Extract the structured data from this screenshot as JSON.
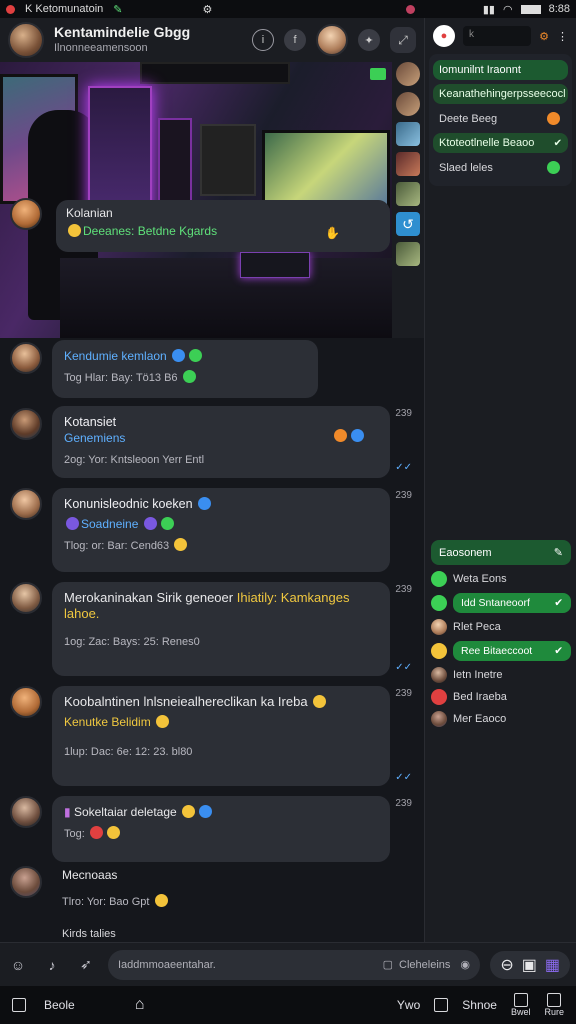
{
  "statusbar": {
    "app": "K Ketomunatoin",
    "time": "8:88"
  },
  "header": {
    "title": "Kentamindelie Gbgg",
    "subtitle": "Ilnonneeamensoon"
  },
  "messages": [
    {
      "name": "Kolanian",
      "text": "Deeanes: Betdne Kgards",
      "time": ""
    },
    {
      "name": "Kendumie kemlaon",
      "text": "Tog Hlar: Bay: Tö13 B6",
      "time": "239"
    },
    {
      "name": "Kotansiet",
      "line2": "Genemiens",
      "meta": "2og: Yor: Kntsleoon  Yerr Entl",
      "time": "239"
    },
    {
      "name": "Konunisleodnic koeken",
      "line2": "Soadneine",
      "meta": "Tlog: or: Bar: Cend63",
      "time": "239"
    },
    {
      "name": "Merokaninakan Sirik geneoer",
      "highlight": "Ihiatily: Kamkanges",
      "line2": "lahoe.",
      "meta": "1og: Zac: Bays: 25: Renes0",
      "time": "239"
    },
    {
      "name": "Koobalntinen lnlsneiealhereclikan ka Ireba",
      "line2": "Kenutke Belidim",
      "meta": "1lup: Dac: 6e: 12: 23. bl80",
      "time": "239"
    },
    {
      "name": "Sokeltaiar deletage",
      "meta": "Tog:",
      "time": "239"
    },
    {
      "name": "Mecnoaas",
      "meta": "Tlro: Yor: Bao Gpt",
      "time": ""
    },
    {
      "name": "Kirds talies",
      "time": ""
    }
  ],
  "right_panel": {
    "search_placeholder": "k",
    "group1": [
      {
        "label": "Iomunilnt Iraonnt",
        "style": "head"
      },
      {
        "label": "Keanathehingerpsseecocl",
        "style": "green"
      },
      {
        "label": "Deete Beeg",
        "style": "plain"
      },
      {
        "label": "Ktoteotlnelle Beaoo",
        "style": "green"
      },
      {
        "label": "Slaed leles",
        "style": "plain"
      }
    ],
    "group2_title": "Eaosonem",
    "group2": [
      {
        "label": "Weta Eons",
        "pill": false
      },
      {
        "label": "Idd Sntaneoorf",
        "pill": true
      },
      {
        "label": "Rlet Peca",
        "pill": false
      },
      {
        "label": "Ree Bitaeccoot",
        "pill": true
      },
      {
        "label": "Ietn Inetre",
        "pill": false
      },
      {
        "label": "Bed Iraeba",
        "pill": false
      },
      {
        "label": "Mer Eaoco",
        "pill": false
      }
    ]
  },
  "composer": {
    "placeholder": "Iaddmmoaeentahar.",
    "mid_label": "Cleheleins"
  },
  "navbar": {
    "left": "Beole",
    "right1": "Ywo",
    "right2": "Shnoe",
    "right3": "Bwel",
    "right4": "Rure"
  }
}
